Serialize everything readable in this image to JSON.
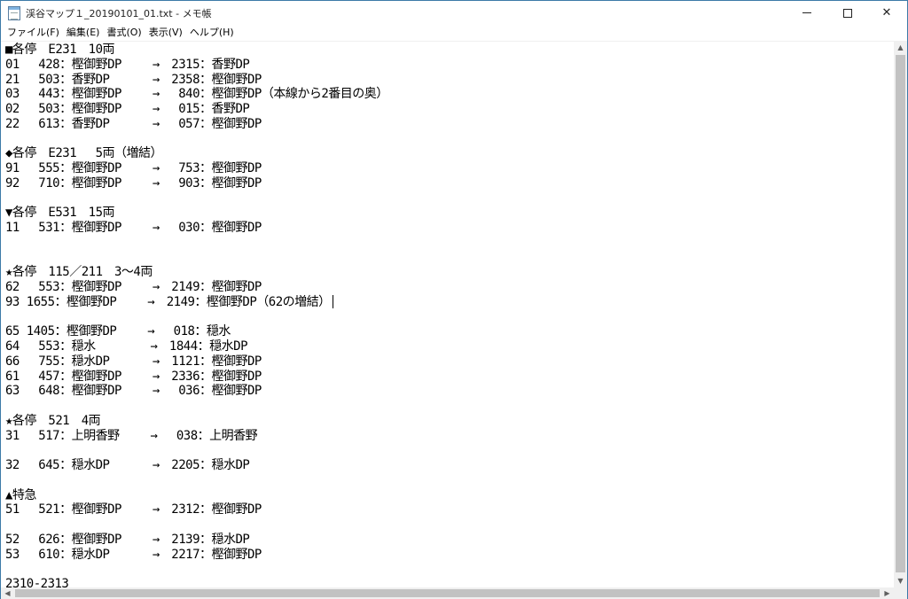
{
  "window": {
    "title": "渓谷マップ１_20190101_01.txt - メモ帳",
    "icon": "notepad-icon",
    "buttons": {
      "minimize": "minimize-icon",
      "maximize": "maximize-icon",
      "close": "✕"
    }
  },
  "menu": [
    "ファイル(F)",
    "編集(E)",
    "書式(O)",
    "表示(V)",
    "ヘルプ(H)"
  ],
  "editor": {
    "lines": [
      "■各停　E231　10両",
      "01　 428：樫御野DP　　 →　2315：香野DP",
      "21　 503：香野DP　　　 →　2358：樫御野DP",
      "03　 443：樫御野DP　　 →　 840：樫御野DP（本線から2番目の奥）",
      "02　 503：樫御野DP　　 →　 015：香野DP",
      "22　 613：香野DP　　　 →　 057：樫御野DP",
      "",
      "◆各停　E231　 5両（増結）",
      "91　 555：樫御野DP　　 →　 753：樫御野DP",
      "92　 710：樫御野DP　　 →　 903：樫御野DP",
      "",
      "▼各停　E531　15両",
      "11　 531：樫御野DP　　 →　 030：樫御野DP",
      "",
      "",
      "★各停　115／211　3～4両",
      "62　 553：樫御野DP　　 →　2149：樫御野DP",
      "93 1655：樫御野DP　　 →　2149：樫御野DP（62の増結）",
      "",
      "65 1405：樫御野DP　　 →　 018：穏水",
      "64　 553：穏水　　　　 →　1844：穏水DP",
      "66　 755：穏水DP　　　 →　1121：樫御野DP",
      "61　 457：樫御野DP　　 →　2336：樫御野DP",
      "63　 648：樫御野DP　　 →　 036：樫御野DP",
      "",
      "★各停　521　4両",
      "31　 517：上明香野　　 →　 038：上明香野",
      "",
      "32　 645：穏水DP　　　 →　2205：穏水DP",
      "",
      "▲特急",
      "51　 521：樫御野DP　　 →　2312：樫御野DP",
      "",
      "52　 626：樫御野DP　　 →　2139：穏水DP",
      "53　 610：穏水DP　　　 →　2217：樫御野DP",
      "",
      "2310-2313"
    ],
    "caret_line_index": 17
  },
  "scrollbars": {
    "vertical": {
      "up": "▲",
      "down": "▼"
    },
    "horizontal": {
      "left": "◀",
      "right": "▶"
    }
  }
}
